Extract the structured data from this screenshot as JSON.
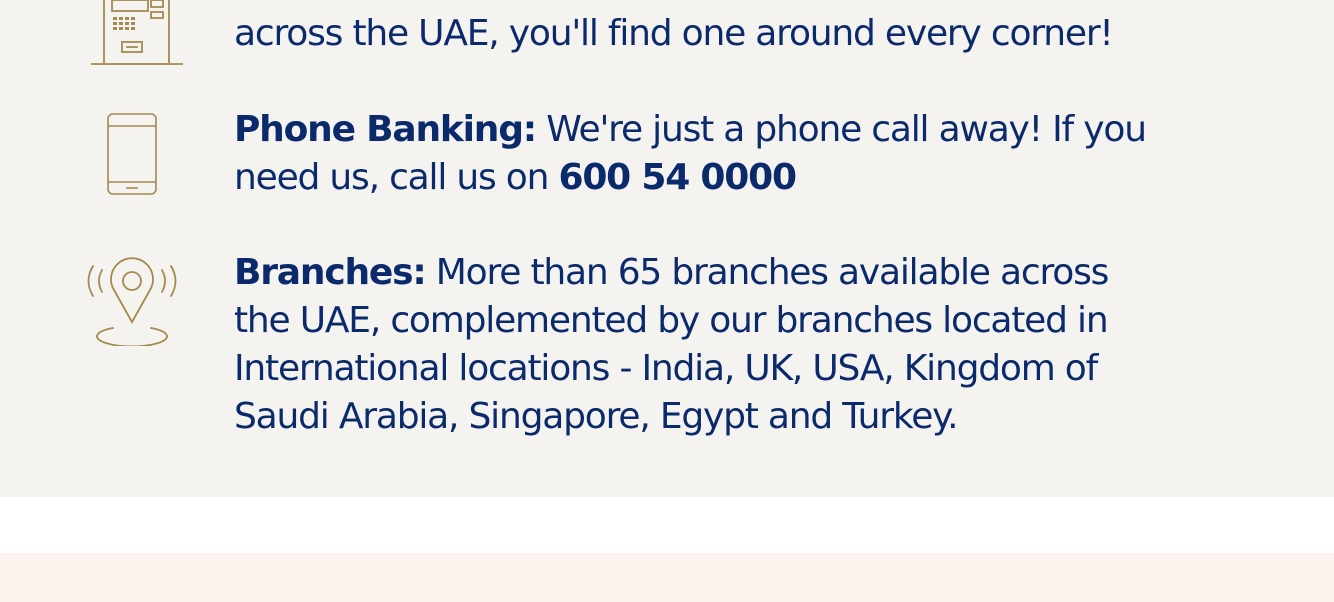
{
  "colors": {
    "panel_bg": "#f4f3ef",
    "text": "#0b2a6b",
    "icon": "#a48a4e",
    "band_bg": "#fdf3ee"
  },
  "features": {
    "atm": {
      "icon": "atm-machine-icon",
      "line1": "across the UAE, you'll find one around every corner!"
    },
    "phone": {
      "icon": "mobile-phone-icon",
      "heading": "Phone Banking:",
      "text1": " We're just a phone call away! If you",
      "text2": "need us, call us on ",
      "number": "600 54 0000"
    },
    "branches": {
      "icon": "location-pin-icon",
      "heading": "Branches:",
      "line1": " More than 65 branches available across",
      "line2": "the UAE, complemented by our branches located in",
      "line3": "International locations - India, UK, USA, Kingdom of",
      "line4": "Saudi Arabia, Singapore, Egypt and Turkey."
    }
  }
}
